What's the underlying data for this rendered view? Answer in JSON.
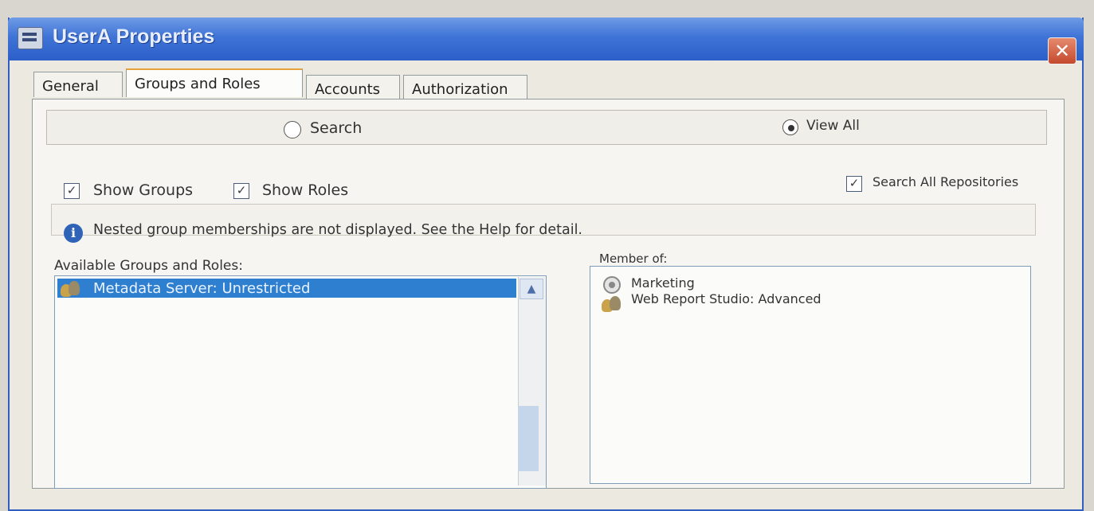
{
  "window": {
    "title": "UserA Properties",
    "close_glyph": "✕"
  },
  "tabs": [
    {
      "label": "General",
      "active": false
    },
    {
      "label": "Groups and Roles",
      "active": true
    },
    {
      "label": "Accounts",
      "active": false
    },
    {
      "label": "Authorization",
      "active": false
    }
  ],
  "mode": {
    "search_label": "Search",
    "search_selected": false,
    "view_all_label": "View All",
    "view_all_selected": true
  },
  "filters": {
    "show_groups_label": "Show Groups",
    "show_groups_checked": true,
    "show_roles_label": "Show Roles",
    "show_roles_checked": true,
    "search_all_repos_label": "Search All Repositories",
    "search_all_repos_checked": true
  },
  "info": {
    "icon": "info-icon",
    "message": "Nested group memberships are not displayed. See the Help for detail."
  },
  "available": {
    "label": "Available Groups and Roles:",
    "items": [
      {
        "label": "Metadata Server: Unrestricted",
        "icon": "group-icon",
        "selected": true
      }
    ]
  },
  "member_of": {
    "label": "Member of:",
    "items": [
      {
        "label": "Marketing",
        "icon": "role-icon"
      },
      {
        "label": "Web Report Studio: Advanced",
        "icon": "group-icon"
      }
    ]
  },
  "colors": {
    "title_bar": "#3f73d6",
    "selection": "#2f7fd0",
    "close_button": "#c44a2e",
    "active_tab_accent": "#e8a23c"
  }
}
